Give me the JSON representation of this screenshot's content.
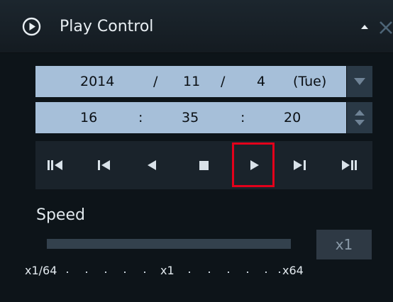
{
  "window": {
    "title": "Play Control",
    "icons": {
      "title": "play-circle-icon",
      "collapse": "chevron-up-icon",
      "close": "close-icon"
    }
  },
  "date": {
    "year": "2014",
    "sep1": "/",
    "month": "11",
    "sep2": "/",
    "day": "4",
    "weekday": "(Tue)",
    "spin_icon": "dropdown-arrow-icon"
  },
  "time": {
    "hour": "16",
    "sep1": ":",
    "minute": "35",
    "sep2": ":",
    "second": "20",
    "spin_icon": "up-down-spinner-icon"
  },
  "transport": {
    "buttons": [
      {
        "name": "jump-to-start",
        "icon": "skip-to-start-icon"
      },
      {
        "name": "previous-frame",
        "icon": "step-back-icon"
      },
      {
        "name": "reverse-play",
        "icon": "reverse-play-icon"
      },
      {
        "name": "stop",
        "icon": "stop-icon"
      },
      {
        "name": "play",
        "icon": "play-icon",
        "highlighted": true
      },
      {
        "name": "next-frame",
        "icon": "step-forward-icon"
      },
      {
        "name": "jump-to-end",
        "icon": "skip-to-end-icon"
      }
    ],
    "highlight_color": "#e3001b"
  },
  "speed": {
    "label": "Speed",
    "value": "x1",
    "scale": {
      "min": "x1/64",
      "mid": "x1",
      "max": "x64"
    }
  },
  "colors": {
    "panel_bg": "#0d1419",
    "field_bg": "#a6bfd9",
    "text_light": "#e2e9ee"
  }
}
